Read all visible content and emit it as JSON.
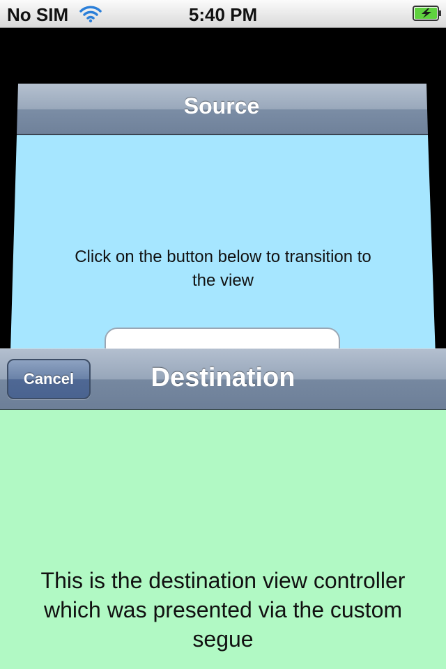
{
  "status_bar": {
    "carrier": "No SIM",
    "time": "5:40 PM",
    "battery_fill_color": "#5fd13f",
    "icons": [
      "wifi-icon",
      "battery-charging-icon"
    ]
  },
  "source": {
    "title": "Source",
    "message": "Click on the button below to transition to the view",
    "background_color": "#a6e6ff"
  },
  "destination": {
    "title": "Destination",
    "cancel_label": "Cancel",
    "message": "This is the destination view controller which was presented via the custom segue",
    "background_color": "#b1f9c4"
  }
}
